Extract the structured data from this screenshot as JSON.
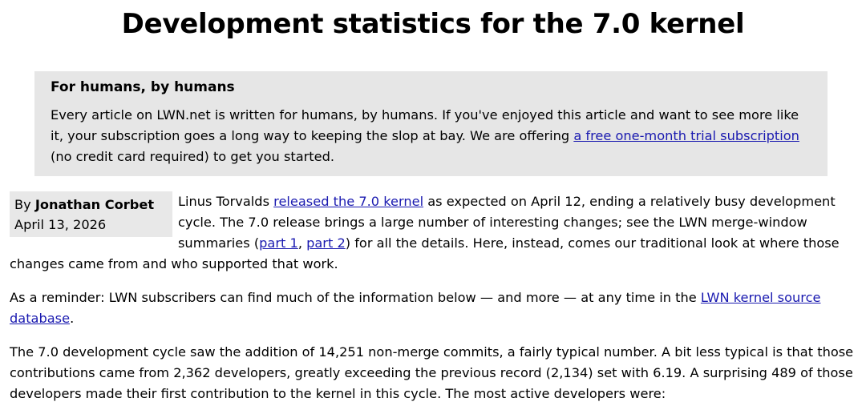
{
  "article": {
    "title": "Development statistics for the 7.0 kernel"
  },
  "promo": {
    "heading": "For humans, by humans",
    "text_before_link": "Every article on LWN.net is written for humans, by humans. If you've enjoyed this article and want to see more like it, your subscription goes a long way to keeping the slop at bay. We are offering ",
    "link_text": "a free one-month trial subscription",
    "text_after_link": " (no credit card required) to get you started."
  },
  "byline": {
    "by": "By ",
    "author": "Jonathan Corbet",
    "date": "April 13, 2026"
  },
  "paragraphs": {
    "p1": {
      "t1": "Linus Torvalds ",
      "link1": "released the 7.0 kernel",
      "t2": " as expected on April 12, ending a relatively busy development cycle. The 7.0 release brings a large number of interesting changes; see the LWN merge-window summaries (",
      "link2": "part 1",
      "t3": ", ",
      "link3": "part 2",
      "t4": ") for all the details. Here, instead, comes our traditional look at where those changes came from and who supported that work."
    },
    "p2": {
      "t1": "As a reminder: LWN subscribers can find much of the information below — and more — at any time in the ",
      "link1": "LWN kernel source database",
      "t2": "."
    },
    "p3": {
      "text": "The 7.0 development cycle saw the addition of 14,251 non-merge commits, a fairly typical number. A bit less typical is that those contributions came from 2,362 developers, greatly exceeding the previous record (2,134) set with 6.19. A surprising 489 of those developers made their first contribution to the kernel in this cycle. The most active developers were:"
    }
  },
  "colors": {
    "link": "#1a1ab0",
    "promo_background": "#e6e6e6",
    "byline_background": "#e8e8e8"
  }
}
